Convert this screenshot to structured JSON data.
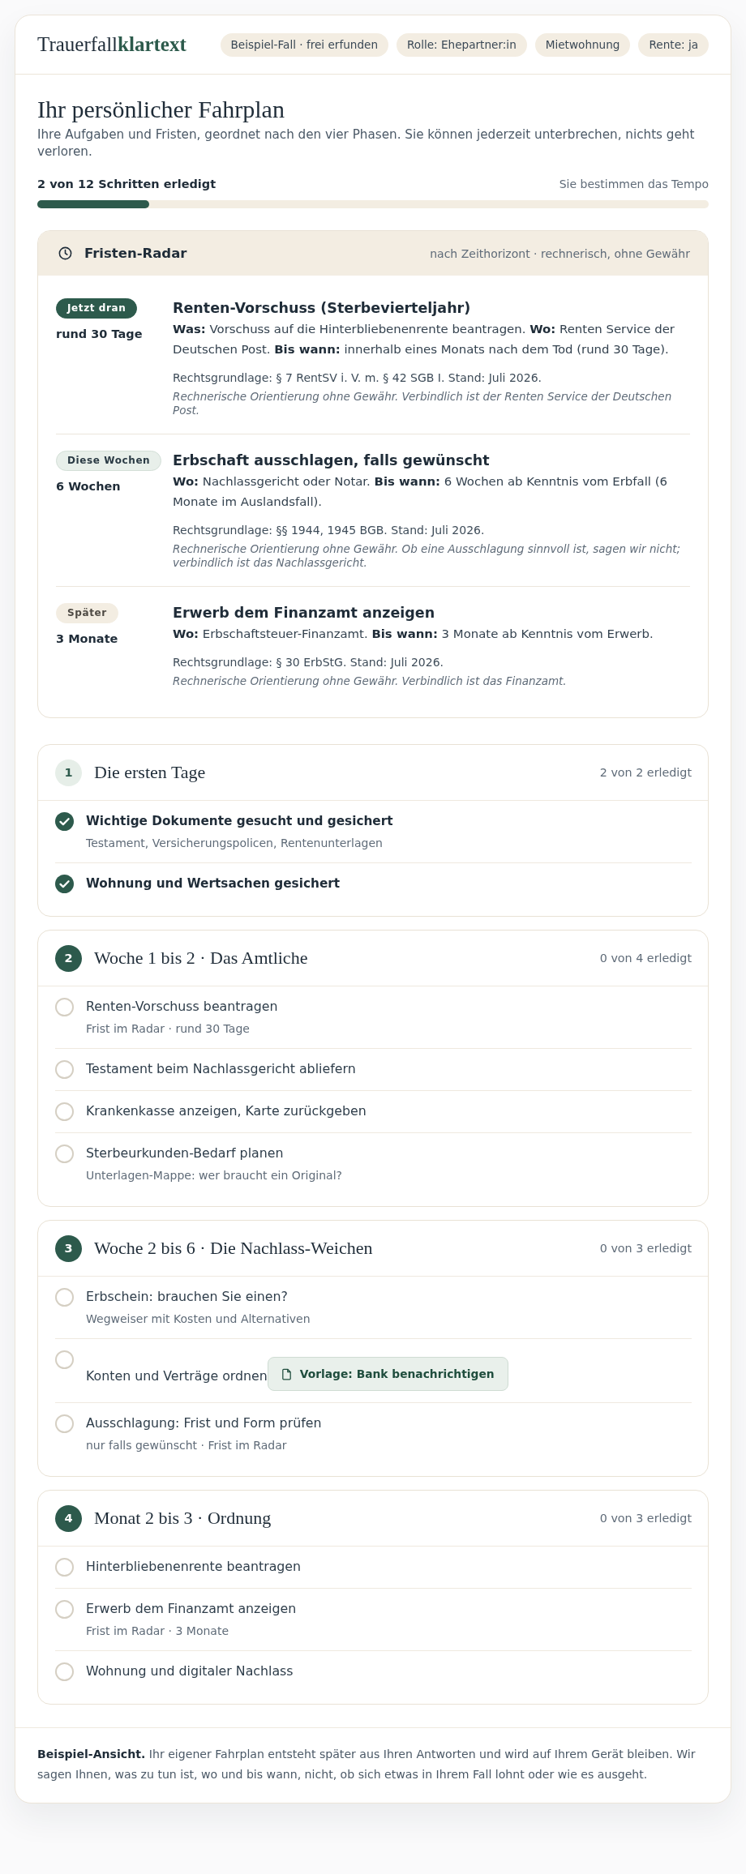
{
  "header": {
    "logo": "Trauerfall**klartext**",
    "tags": [
      "Beispiel-Fall · frei erfunden",
      "Rolle: Ehepartner:in",
      "Mietwohnung",
      "Rente: ja"
    ]
  },
  "intro": {
    "title": "Ihr persönlicher Fahrplan",
    "subtitle": "Ihre Aufgaben und Fristen, geordnet nach den vier Phasen. Sie können jederzeit unterbrechen, nichts geht verloren."
  },
  "progress": {
    "label": "2 von 12 Schritten erledigt",
    "note": "Sie bestimmen das Tempo",
    "level": 0.1667
  },
  "radar": {
    "title": "Fristen-Radar",
    "note": "nach Zeithorizont · rechnerisch, ohne Gewähr",
    "entries": [
      {
        "kind": "now",
        "badge": "Jetzt dran",
        "horizon": "rund 30 Tage",
        "title": "Renten-Vorschuss (Sterbevierteljahr)",
        "text": "**Was:** Vorschuss auf die Hinterbliebenenrente beantragen. **Wo:** Renten Service der Deutschen Post. **Bis wann:** innerhalb eines Monats nach dem Tod (rund 30 Tage).",
        "legal": "Rechtsgrundlage: § 7 RentSV i. V. m. § 42 SGB I. Stand: Juli 2026.",
        "disclaimer": "Rechnerische Orientierung ohne Gewähr. Verbindlich ist der Renten Service der Deutschen Post."
      },
      {
        "kind": "soon",
        "badge": "Diese Wochen",
        "horizon": "6 Wochen",
        "title": "Erbschaft ausschlagen, falls gewünscht",
        "text": "**Wo:** Nachlassgericht oder Notar. **Bis wann:** 6 Wochen ab Kenntnis vom Erbfall (6 Monate im Auslandsfall).",
        "legal": "Rechtsgrundlage: §§ 1944, 1945 BGB. Stand: Juli 2026.",
        "disclaimer": "Rechnerische Orientierung ohne Gewähr. Ob eine Ausschlagung sinnvoll ist, sagen wir nicht; verbindlich ist das Nachlassgericht."
      },
      {
        "kind": "later",
        "badge": "Später",
        "horizon": "3 Monate",
        "title": "Erwerb dem Finanzamt anzeigen",
        "text": "**Wo:** Erbschaftsteuer-Finanzamt. **Bis wann:** 3 Monate ab Kenntnis vom Erwerb.",
        "legal": "Rechtsgrundlage: § 30 ErbStG. Stand: Juli 2026.",
        "disclaimer": "Rechnerische Orientierung ohne Gewähr. Verbindlich ist das Finanzamt."
      }
    ]
  },
  "phases": [
    {
      "number": "1",
      "title": "Die ersten Tage",
      "count": "2 von 2 erledigt",
      "complete": true,
      "tasks": [
        {
          "title": "Wichtige Dokumente gesucht und gesichert",
          "note": "Testament, Versicherungspolicen, Rentenunterlagen",
          "checked": true
        },
        {
          "title": "Wohnung und Wertsachen gesichert",
          "checked": true
        }
      ]
    },
    {
      "number": "2",
      "title": "Woche 1 bis 2 · Das Amtliche",
      "count": "0 von 4 erledigt",
      "complete": false,
      "tasks": [
        {
          "title": "Renten-Vorschuss beantragen",
          "note": "Frist im Radar · rund 30 Tage",
          "checked": false
        },
        {
          "title": "Testament beim Nachlassgericht abliefern",
          "checked": false
        },
        {
          "title": "Krankenkasse anzeigen, Karte zurückgeben",
          "checked": false
        },
        {
          "title": "Sterbeurkunden-Bedarf planen",
          "note": "Unterlagen-Mappe: wer braucht ein Original?",
          "checked": false
        }
      ]
    },
    {
      "number": "3",
      "title": "Woche 2 bis 6 · Die Nachlass-Weichen",
      "count": "0 von 3 erledigt",
      "complete": false,
      "tasks": [
        {
          "title": "Erbschein: brauchen Sie einen?",
          "note": "Wegweiser mit Kosten und Alternativen",
          "checked": false
        },
        {
          "title": "Konten und Verträge ordnen",
          "action": "Vorlage: Bank benachrichtigen",
          "checked": false
        },
        {
          "title": "Ausschlagung: Frist und Form prüfen",
          "note": "nur falls gewünscht · Frist im Radar",
          "checked": false
        }
      ]
    },
    {
      "number": "4",
      "title": "Monat 2 bis 3 · Ordnung",
      "count": "0 von 3 erledigt",
      "complete": false,
      "tasks": [
        {
          "title": "Hinterbliebenenrente beantragen",
          "checked": false
        },
        {
          "title": "Erwerb dem Finanzamt anzeigen",
          "note": "Frist im Radar · 3 Monate",
          "checked": false
        },
        {
          "title": "Wohnung und digitaler Nachlass",
          "checked": false
        }
      ]
    }
  ],
  "footer": {
    "text": "**Beispiel-Ansicht.** Ihr eigener Fahrplan entsteht später aus Ihren Antworten und wird auf Ihrem Gerät bleiben. Wir sagen Ihnen, was zu tun ist, wo und bis wann, nicht, ob sich etwas in Ihrem Fall lohnt oder wie es ausgeht."
  }
}
